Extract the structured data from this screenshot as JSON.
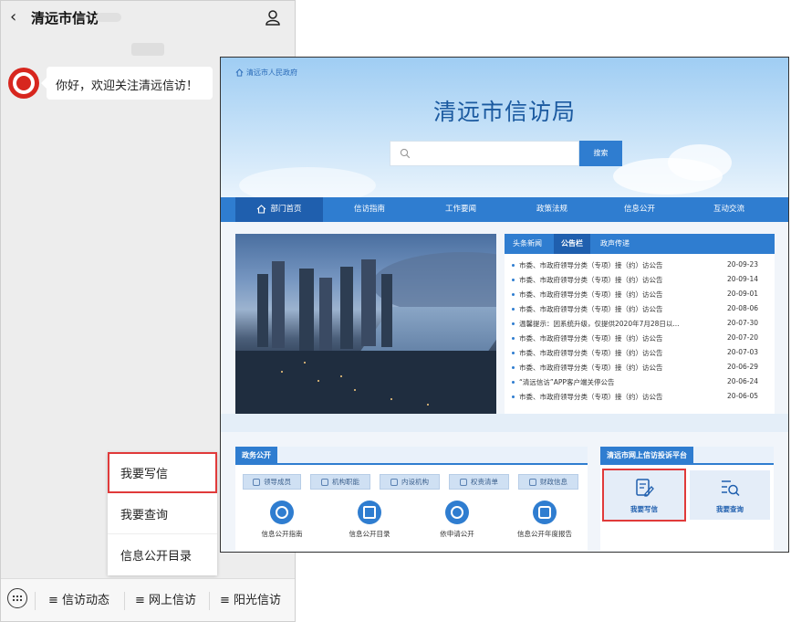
{
  "phone": {
    "title": "清远市信访",
    "back_icon": "chevron-left-icon",
    "user_icon": "user-icon",
    "message": "你好，欢迎关注清远信访！",
    "menu": [
      "我要写信",
      "我要查询",
      "信息公开目录"
    ],
    "bottom_tabs": [
      "≡ 信访动态",
      "≡ 网上信访",
      "≡ 阳光信访"
    ],
    "keyboard_icon": "keyboard-icon"
  },
  "site": {
    "gov_link": "清远市人民政府",
    "title": "清远市信访局",
    "search_button": "搜索",
    "search_placeholder": "",
    "nav": [
      "部门首页",
      "信访指南",
      "工作要闻",
      "政策法规",
      "信息公开",
      "互动交流"
    ],
    "news_tabs": [
      "头条新闻",
      "公告栏",
      "政声传递"
    ],
    "news": [
      {
        "text": "市委、市政府领导分类（专项）接（约）访公告",
        "date": "20-09-23"
      },
      {
        "text": "市委、市政府领导分类（专项）接（约）访公告",
        "date": "20-09-14"
      },
      {
        "text": "市委、市政府领导分类（专项）接（约）访公告",
        "date": "20-09-01"
      },
      {
        "text": "市委、市政府领导分类（专项）接（约）访公告",
        "date": "20-08-06"
      },
      {
        "text": "温馨提示：因系统升级，仅提供2020年7月28日以...",
        "date": "20-07-30"
      },
      {
        "text": "市委、市政府领导分类（专项）接（约）访公告",
        "date": "20-07-20"
      },
      {
        "text": "市委、市政府领导分类（专项）接（约）访公告",
        "date": "20-07-03"
      },
      {
        "text": "市委、市政府领导分类（专项）接（约）访公告",
        "date": "20-06-29"
      },
      {
        "text": "“清远信访”APP客户端关停公告",
        "date": "20-06-24"
      },
      {
        "text": "市委、市政府领导分类（专项）接（约）访公告",
        "date": "20-06-05"
      }
    ],
    "gov_open": {
      "heading": "政务公开",
      "chips": [
        "领导成员",
        "机构职能",
        "内设机构",
        "权责清单",
        "财政信息"
      ],
      "links": [
        "信息公开指南",
        "信息公开目录",
        "依申请公开",
        "信息公开年度报告"
      ]
    },
    "petition": {
      "heading": "清远市网上信访投诉平台",
      "write": "我要写信",
      "query": "我要查询"
    }
  },
  "colors": {
    "brand_blue": "#2f7dd0",
    "highlight_red": "#e03a3a"
  }
}
